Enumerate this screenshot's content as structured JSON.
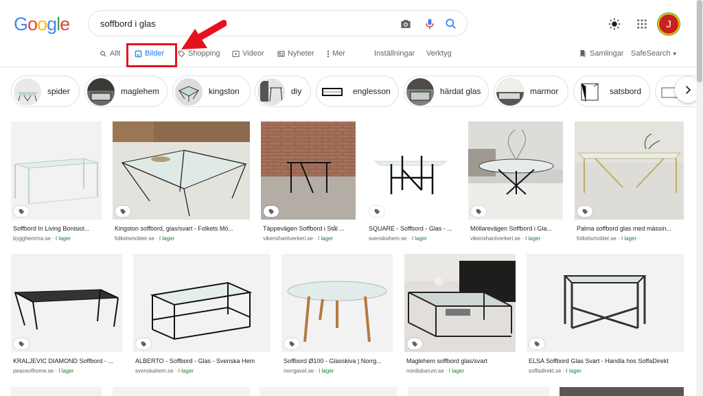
{
  "logo": [
    "G",
    "o",
    "o",
    "g",
    "l",
    "e"
  ],
  "search": {
    "query": "soffbord i glas"
  },
  "tabs": [
    {
      "label": "Allt",
      "icon": "search-icon"
    },
    {
      "label": "Bilder",
      "icon": "image-icon",
      "active": true
    },
    {
      "label": "Shopping",
      "icon": "tag-icon"
    },
    {
      "label": "Videor",
      "icon": "play-icon"
    },
    {
      "label": "Nyheter",
      "icon": "news-icon"
    },
    {
      "label": "Mer",
      "icon": "more-icon"
    }
  ],
  "tools": {
    "settings": "Inställningar",
    "tools": "Verktyg"
  },
  "right": {
    "collections": "Samlingar",
    "safesearch": "SafeSearch"
  },
  "avatar": {
    "letter": "J",
    "color": "#c5221f"
  },
  "chips": [
    "spider",
    "maglehem",
    "kingston",
    "diy",
    "englesson",
    "härdat glas",
    "marmor",
    "satsbord"
  ],
  "row1": [
    {
      "title": "Soffbord In Living Bonisiol...",
      "source": "bygghemma.se",
      "stock": "I lager"
    },
    {
      "title": "Kingston soffbord, glas/svart - Folkets Mö...",
      "source": "folketsmobler.se",
      "stock": "I lager"
    },
    {
      "title": "Täppevägen Soffbord i Stål ...",
      "source": "vikenshantverkeri.se",
      "stock": "I lager"
    },
    {
      "title": "SQUARE - Soffbord - Glas - ...",
      "source": "svenskahem.se",
      "stock": "I lager"
    },
    {
      "title": "Möllarevägen Soffbord i Gla...",
      "source": "vikenshantverkeri.se",
      "stock": "I lager"
    },
    {
      "title": "Palma soffbord glas med mässin...",
      "source": "folketsmobler.se",
      "stock": "I lager"
    }
  ],
  "row2": [
    {
      "title": "KRALJEVIC DIAMOND Soffbord - ...",
      "source": "peaceofhome.se",
      "stock": "I lager"
    },
    {
      "title": "ALBERTO - Soffbord - Glas - Svenska Hem",
      "source": "svenskahem.se",
      "stock": "I lager"
    },
    {
      "title": "Soffbord Ø100 - Glasskiva | Norrg...",
      "source": "norrgavel.se",
      "stock": "I lager"
    },
    {
      "title": "Maglehem soffbord glas/svart",
      "source": "nordiskarum.se",
      "stock": "I lager"
    },
    {
      "title": "ELSA Soffbord Glas Svart - Handla hos SoffaDirekt",
      "source": "soffadirekt.se",
      "stock": "I lager"
    }
  ],
  "colors": {
    "accent": "#1a73e8",
    "highlight": "#e8101d",
    "stock": "#188038"
  }
}
